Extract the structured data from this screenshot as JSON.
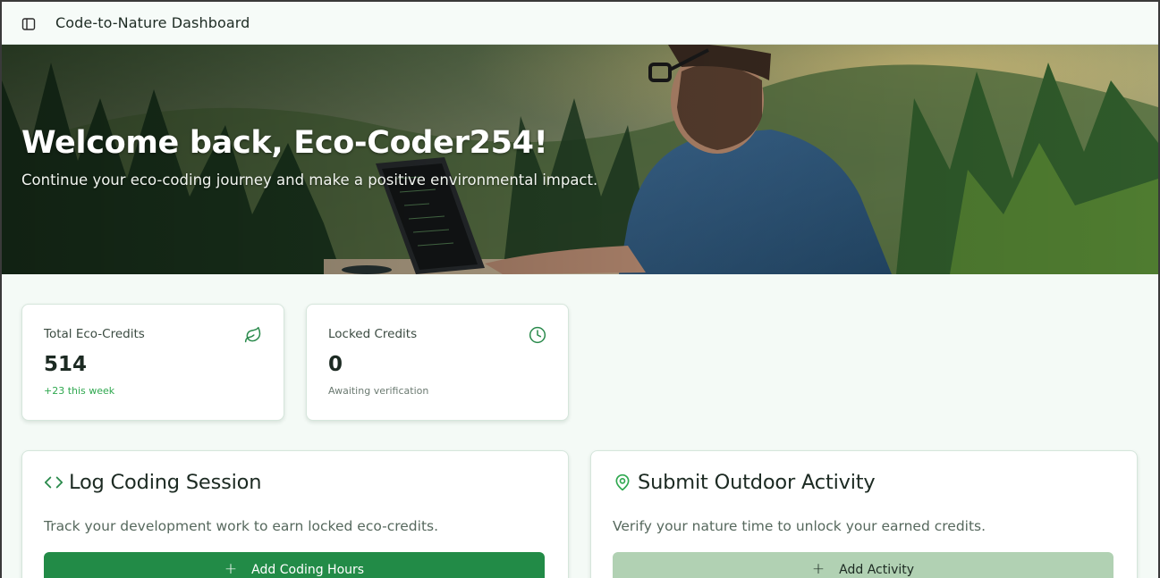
{
  "header": {
    "title": "Code-to-Nature Dashboard",
    "toggle_icon": "sidebar-toggle-icon"
  },
  "hero": {
    "title": "Welcome back, Eco-Coder254!",
    "subtitle": "Continue your eco-coding journey and make a positive environmental impact."
  },
  "stats": [
    {
      "label": "Total Eco-Credits",
      "value": "514",
      "note": "+23 this week",
      "icon": "leaf-icon",
      "note_color": "#2fa84f"
    },
    {
      "label": "Locked Credits",
      "value": "0",
      "note": "Awaiting verification",
      "icon": "clock-icon",
      "note_color": "#6b7a71"
    }
  ],
  "actions": [
    {
      "title": "Log Coding Session",
      "description": "Track your development work to earn locked eco-credits.",
      "button": "Add Coding Hours",
      "icon": "code-icon"
    },
    {
      "title": "Submit Outdoor Activity",
      "description": "Verify your nature time to unlock your earned credits.",
      "button": "Add Activity",
      "icon": "map-pin-icon"
    }
  ],
  "colors": {
    "primary": "#228b47",
    "primary_muted": "#b1d1b3",
    "accent_icon": "#2a8a4c"
  }
}
